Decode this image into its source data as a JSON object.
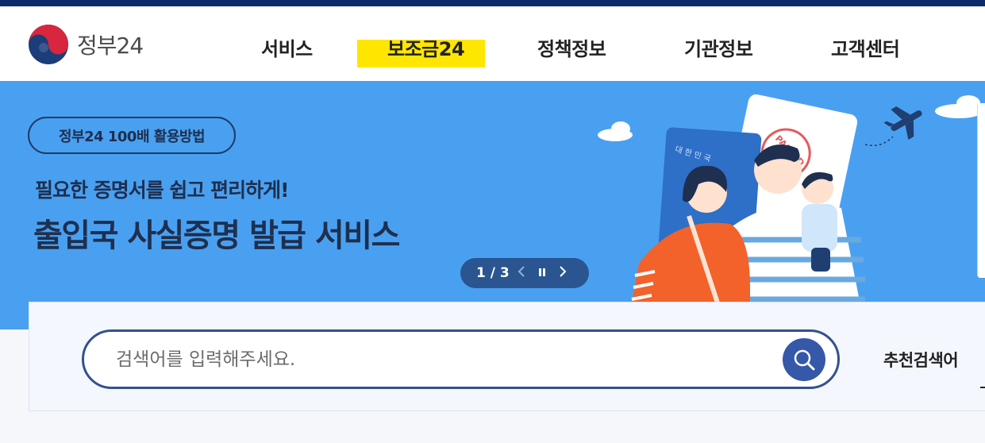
{
  "header": {
    "logo_text": "정부24",
    "nav": [
      {
        "label": "서비스"
      },
      {
        "label": "보조금24"
      },
      {
        "label": "정책정보"
      },
      {
        "label": "기관정보"
      },
      {
        "label": "고객센터"
      }
    ]
  },
  "banner": {
    "pill": "정부24 100배 활용방법",
    "subtitle": "필요한 증명서를 쉽고 편리하게!",
    "title": "출입국 사실증명 발급 서비스",
    "pager": {
      "counter": "1 / 3",
      "prev_icon": "chevron-left-icon",
      "pause_icon": "pause-icon",
      "next_icon": "chevron-right-icon"
    },
    "illustration": {
      "stamp_text": "PASSED",
      "passport_text": "대 한 민 국"
    }
  },
  "search": {
    "placeholder": "검색어를 입력해주세요.",
    "value": "",
    "button_icon": "search-icon",
    "recommend_label": "추천검색어"
  },
  "colors": {
    "top_strip": "#0d2a6b",
    "banner_bg": "#4aa0f0",
    "highlight": "#ffe600",
    "search_border": "#34508f",
    "search_button": "#3558a8"
  }
}
